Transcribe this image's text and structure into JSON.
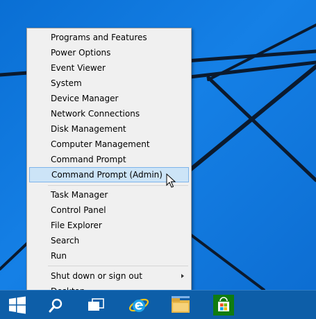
{
  "menu": {
    "items": [
      {
        "label": "Programs and Features"
      },
      {
        "label": "Power Options"
      },
      {
        "label": "Event Viewer"
      },
      {
        "label": "System"
      },
      {
        "label": "Device Manager"
      },
      {
        "label": "Network Connections"
      },
      {
        "label": "Disk Management"
      },
      {
        "label": "Computer Management"
      },
      {
        "label": "Command Prompt"
      },
      {
        "label": "Command Prompt (Admin)"
      },
      {
        "label": "Task Manager"
      },
      {
        "label": "Control Panel"
      },
      {
        "label": "File Explorer"
      },
      {
        "label": "Search"
      },
      {
        "label": "Run"
      },
      {
        "label": "Shut down or sign out"
      },
      {
        "label": "Desktop"
      }
    ],
    "highlighted_item": "Command Prompt (Admin)"
  },
  "taskbar": {
    "items": [
      {
        "icon": "windows-start-icon"
      },
      {
        "icon": "search-icon"
      },
      {
        "icon": "task-view-icon"
      },
      {
        "icon": "internet-explorer-icon"
      },
      {
        "icon": "file-explorer-icon"
      },
      {
        "icon": "store-icon"
      }
    ]
  },
  "colors": {
    "desktop": "#0a6fd4",
    "taskbar": "#0d5ea8",
    "menu_bg": "#f0f0f0",
    "highlight_bg": "#cce4f7",
    "highlight_border": "#7eb4ea",
    "store_green": "#107c10"
  }
}
